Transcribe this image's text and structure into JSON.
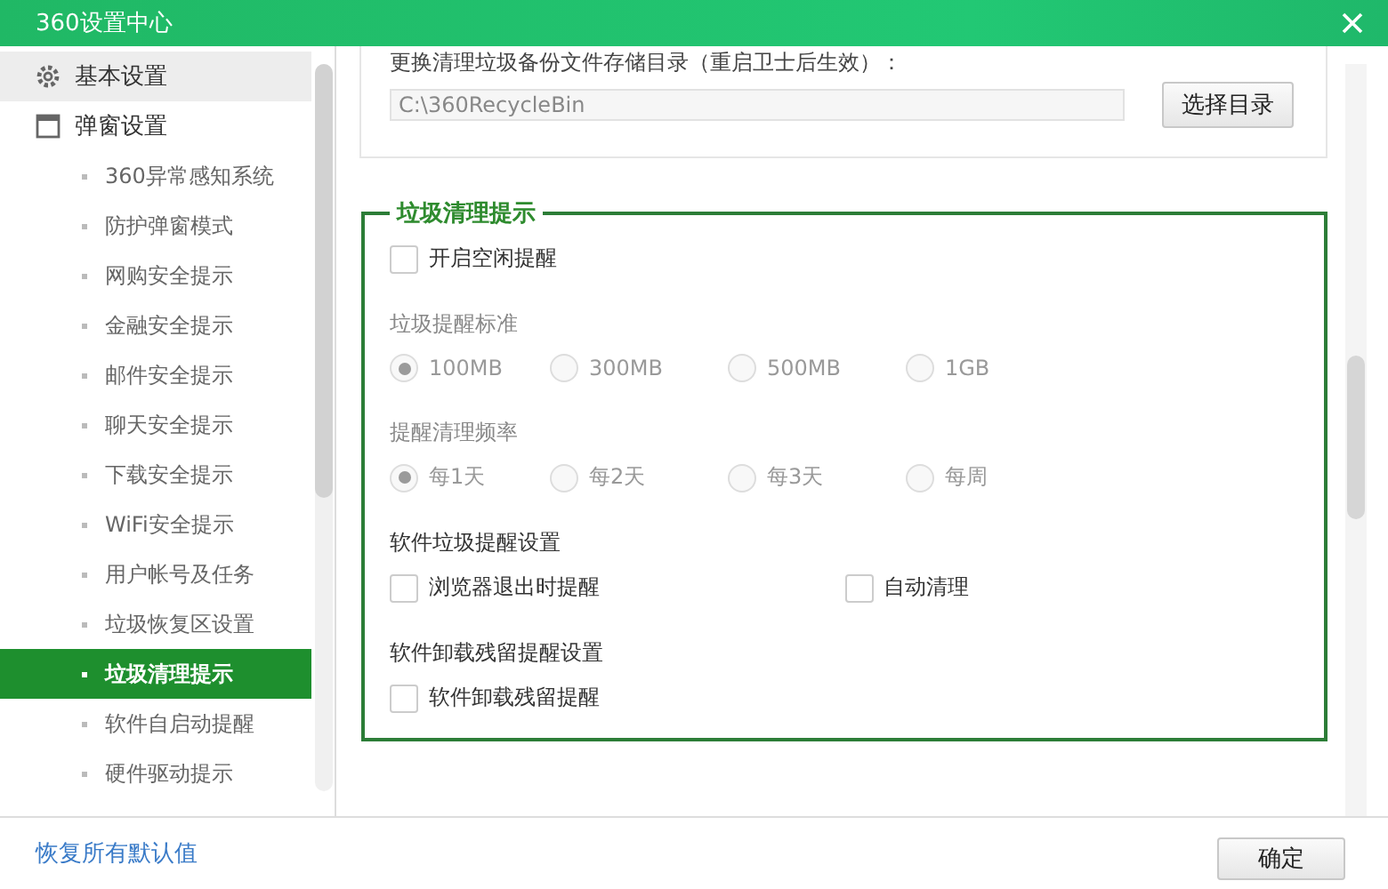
{
  "window": {
    "title": "360设置中心"
  },
  "sidebar": {
    "groups": [
      {
        "label": "基本设置",
        "hovered": true
      },
      {
        "label": "弹窗设置",
        "hovered": false,
        "children": [
          {
            "label": "360异常感知系统",
            "selected": false
          },
          {
            "label": "防护弹窗模式",
            "selected": false
          },
          {
            "label": "网购安全提示",
            "selected": false
          },
          {
            "label": "金融安全提示",
            "selected": false
          },
          {
            "label": "邮件安全提示",
            "selected": false
          },
          {
            "label": "聊天安全提示",
            "selected": false
          },
          {
            "label": "下载安全提示",
            "selected": false
          },
          {
            "label": "WiFi安全提示",
            "selected": false
          },
          {
            "label": "用户帐号及任务",
            "selected": false
          },
          {
            "label": "垃圾恢复区设置",
            "selected": false
          },
          {
            "label": "垃圾清理提示",
            "selected": true
          },
          {
            "label": "软件自启动提醒",
            "selected": false
          },
          {
            "label": "硬件驱动提示",
            "selected": false
          }
        ]
      }
    ]
  },
  "directory": {
    "label": "更换清理垃圾备份文件存储目录（重启卫士后生效）：",
    "value": "C:\\360RecycleBin",
    "button": "选择目录"
  },
  "group": {
    "title": "垃圾清理提示",
    "sections": [
      {
        "kind": "checks",
        "items": [
          {
            "label": "开启空闲提醒",
            "checked": false
          }
        ]
      },
      {
        "kind": "radios",
        "label": "垃圾提醒标准",
        "disabled": true,
        "items": [
          {
            "label": "100MB",
            "selected": true
          },
          {
            "label": "300MB",
            "selected": false
          },
          {
            "label": "500MB",
            "selected": false
          },
          {
            "label": "1GB",
            "selected": false
          }
        ]
      },
      {
        "kind": "radios",
        "label": "提醒清理频率",
        "disabled": true,
        "items": [
          {
            "label": "每1天",
            "selected": true
          },
          {
            "label": "每2天",
            "selected": false
          },
          {
            "label": "每3天",
            "selected": false
          },
          {
            "label": "每周",
            "selected": false
          }
        ]
      },
      {
        "kind": "checks",
        "label": "软件垃圾提醒设置",
        "items": [
          {
            "label": "浏览器退出时提醒",
            "checked": false
          },
          {
            "label": "自动清理",
            "checked": false
          }
        ]
      },
      {
        "kind": "checks",
        "label": "软件卸载残留提醒设置",
        "items": [
          {
            "label": "软件卸载残留提醒",
            "checked": false
          }
        ]
      }
    ]
  },
  "footer": {
    "restore": "恢复所有默认值",
    "ok": "确定"
  }
}
